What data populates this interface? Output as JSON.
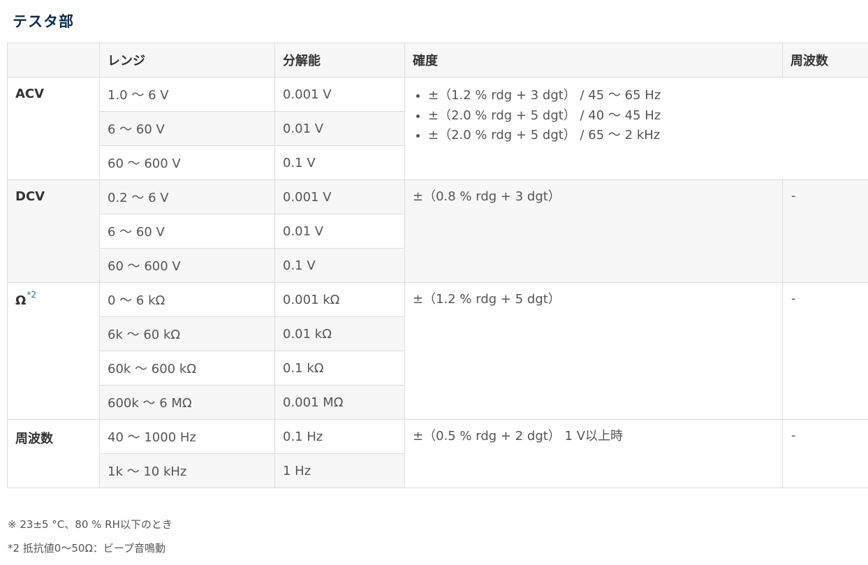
{
  "section_title": "テスタ部",
  "table": {
    "headers": [
      "",
      "レンジ",
      "分解能",
      "確度",
      "周波数"
    ],
    "acv": {
      "label": "ACV",
      "ranges": [
        "1.0 ～ 6 V",
        "6 ～ 60 V",
        "60 ～ 600 V"
      ],
      "resolutions": [
        "0.001 V",
        "0.01 V",
        "0.1 V"
      ],
      "accuracy": [
        "±（1.2 % rdg + 3 dgt） / 45 ～ 65 Hz",
        "±（2.0 % rdg + 5 dgt） / 40 ～ 45 Hz",
        "±（2.0 % rdg + 5 dgt） / 65 ～ 2 kHz"
      ]
    },
    "dcv": {
      "label": "DCV",
      "ranges": [
        "0.2 ～ 6 V",
        "6 ～ 60 V",
        "60 ～ 600 V"
      ],
      "resolutions": [
        "0.001 V",
        "0.01 V",
        "0.1 V"
      ],
      "accuracy": "±（0.8 % rdg + 3 dgt）",
      "frequency": "-"
    },
    "ohm": {
      "label": "Ω",
      "note_ref": "*2",
      "ranges": [
        "0 ～ 6 kΩ",
        "6k ～ 60 kΩ",
        "60k ～ 600 kΩ",
        "600k ～ 6 MΩ"
      ],
      "resolutions": [
        "0.001 kΩ",
        "0.01 kΩ",
        "0.1 kΩ",
        "0.001 MΩ"
      ],
      "accuracy": "±（1.2 % rdg + 5 dgt）",
      "frequency": "-"
    },
    "freq": {
      "label": "周波数",
      "ranges": [
        "40 ～ 1000 Hz",
        "1k ～ 10 kHz"
      ],
      "resolutions": [
        "0.1 Hz",
        "1 Hz"
      ],
      "accuracy": "±（0.5 % rdg + 2 dgt） 1 V以上時",
      "frequency": "-"
    }
  },
  "notes": [
    "※ 23±5 °C、80 % RH以下のとき",
    "*2 抵抗値0～50Ω：ビープ音鳴動"
  ]
}
